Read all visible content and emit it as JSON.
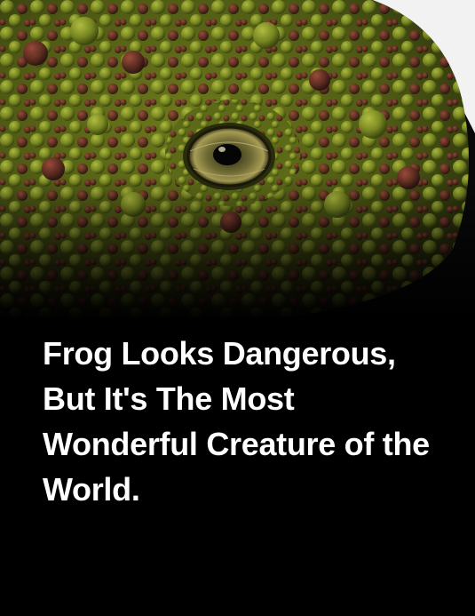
{
  "article": {
    "headline": "Frog Looks Dangerous, But It's The Most Wonderful Creature of the World.",
    "image": {
      "subject": "frog-closeup",
      "colors": {
        "skin_green": "#7f8f1e",
        "tubercle_red": "#6b2a22",
        "background_white": "#f2f2f2",
        "fade_black": "#000000"
      }
    }
  }
}
